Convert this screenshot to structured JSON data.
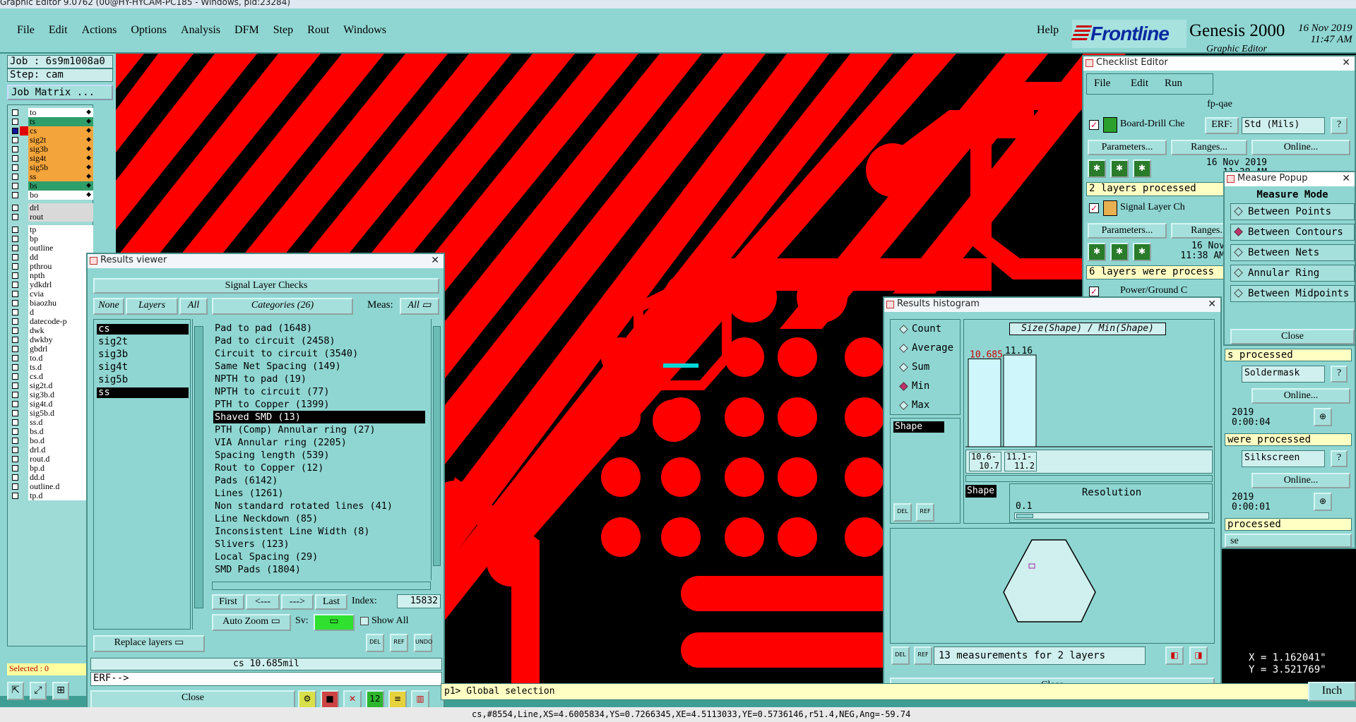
{
  "window_title": "Graphic Editor 9.0762 (00@HY-HYCAM-PC185 - Windows, pid:23284)",
  "menu": [
    "File",
    "Edit",
    "Actions",
    "Options",
    "Analysis",
    "DFM",
    "Step",
    "Rout",
    "Windows"
  ],
  "help": "Help",
  "brand": {
    "logo": "Frontline",
    "product": "Genesis 2000",
    "subtitle": "Graphic Editor",
    "date": "16 Nov 2019",
    "time": "11:47 AM"
  },
  "job": {
    "job": "Job : 6s9m1008a0",
    "step": "Step: cam",
    "matrix_btn": "Job Matrix ..."
  },
  "board_layers": [
    {
      "name": "to",
      "color": "#ffffff",
      "selected": false
    },
    {
      "name": "ts",
      "color": "#2e9e6a",
      "selected": false
    },
    {
      "name": "cs",
      "color": "#f3a43a",
      "selected": true
    },
    {
      "name": "sig2t",
      "color": "#f3a43a",
      "selected": false
    },
    {
      "name": "sig3b",
      "color": "#f3a43a",
      "selected": false
    },
    {
      "name": "sig4t",
      "color": "#f3a43a",
      "selected": false
    },
    {
      "name": "sig5b",
      "color": "#f3a43a",
      "selected": false
    },
    {
      "name": "ss",
      "color": "#f3a43a",
      "selected": false
    },
    {
      "name": "bs",
      "color": "#2e9e6a",
      "selected": false
    },
    {
      "name": "bo",
      "color": "#ffffff",
      "selected": false
    }
  ],
  "drill_layers": [
    "drl",
    "rout"
  ],
  "misc_layers": [
    "tp",
    "bp",
    "outline",
    "dd",
    "pthrou",
    "npth",
    "ydkdrl",
    "cvia",
    "biaozhu",
    "d",
    "datecode-p",
    "dwk",
    "dwkby",
    "gbdrl",
    "to.d",
    "ts.d",
    "cs.d",
    "sig2t.d",
    "sig3b.d",
    "sig4t.d",
    "sig5b.d",
    "ss.d",
    "bs.d",
    "bo.d",
    "drl.d",
    "rout.d",
    "bp.d",
    "dd.d",
    "outline.d",
    "tp.d"
  ],
  "selected": "Selected : 0",
  "results_viewer": {
    "title": "Results viewer",
    "header": "Signal Layer Checks",
    "none": "None",
    "layers": "Layers",
    "all": "All",
    "categories_label": "Categories (26)",
    "meas": "Meas:",
    "meas_val": "All",
    "layer_list": [
      "cs",
      "sig2t",
      "sig3b",
      "sig4t",
      "sig5b",
      "ss"
    ],
    "categories": [
      "Pad to pad (1648)",
      "Pad to circuit (2458)",
      "Circuit to circuit (3540)",
      "Same Net Spacing (149)",
      "NPTH to pad (19)",
      "NPTH to circuit (77)",
      "PTH to Copper (1399)",
      "Shaved SMD (13)",
      "PTH (Comp) Annular ring (27)",
      "VIA Annular ring (2205)",
      "Spacing length (539)",
      "Rout to Copper (12)",
      "Pads (6142)",
      "Lines (1261)",
      "Non standard rotated lines (41)",
      "Line Neckdown (85)",
      "Inconsistent Line Width (8)",
      "Slivers (123)",
      "Local Spacing (29)",
      "SMD Pads (1804)"
    ],
    "first": "First",
    "prev": "<---",
    "next": "--->",
    "last": "Last",
    "index_label": "Index:",
    "index_val": "15832",
    "auto_zoom": "Auto Zoom",
    "sv": "Sv:",
    "show_all": "Show All",
    "replace_layers": "Replace layers",
    "del": "DEL",
    "ref": "REF",
    "undo": "UNDO",
    "status": "cs 10.685mil",
    "erf": "ERF-->",
    "close": "Close"
  },
  "checklist": {
    "title": "Checklist Editor",
    "menu": [
      "File",
      "Edit",
      "Run"
    ],
    "name": "fp-qae",
    "erf": "ERF:",
    "params": "Parameters...",
    "ranges": "Ranges...",
    "online": "Online...",
    "items": [
      {
        "name": "Board-Drill Che",
        "erf": "Std (Mils)",
        "date": "16 Nov 2019",
        "time": "11:38 AM",
        "status": "2 layers processed"
      },
      {
        "name": "Signal Layer Ch",
        "erf": "",
        "date": "16 Nov",
        "time": "11:38 AM",
        "status": "6 layers were process"
      },
      {
        "name": "Power/Ground C",
        "erf": "",
        "date": "",
        "time": "",
        "status": "s processed"
      }
    ],
    "soldermask": "Soldermask",
    "silkscreen": "Silkscreen",
    "r1_date": "2019",
    "r1_time": "0:00:04",
    "r1_status": "were processed",
    "r2_date": "2019",
    "r2_time": "0:00:01",
    "r2_status": "processed",
    "se": "se"
  },
  "measure": {
    "title": "Measure Popup",
    "header": "Measure Mode",
    "modes": [
      {
        "label": "Between Points",
        "on": false
      },
      {
        "label": "Between Contours",
        "on": true
      },
      {
        "label": "Between Nets",
        "on": false
      },
      {
        "label": "Annular Ring",
        "on": false
      },
      {
        "label": "Between Midpoints",
        "on": false
      }
    ],
    "close": "Close"
  },
  "histogram": {
    "title": "Results histogram",
    "modes": [
      {
        "label": "Count",
        "on": false
      },
      {
        "label": "Average",
        "on": false
      },
      {
        "label": "Sum",
        "on": false
      },
      {
        "label": "Min",
        "on": true
      },
      {
        "label": "Max",
        "on": false
      }
    ],
    "chart_title": "Size(Shape) / Min(Shape)",
    "shape": "Shape",
    "bars": [
      {
        "label": "10.685",
        "range1": "10.6-",
        "range2": "10.7",
        "value": 10.685
      },
      {
        "label": "11.16",
        "range1": "11.1-",
        "range2": "11.2",
        "value": 11.16
      }
    ],
    "resolution_label": "Resolution",
    "resolution_val": "0.1",
    "measurements": "13 measurements for 2 layers",
    "del": "DEL",
    "ref": "REF",
    "close": "Close"
  },
  "cmdbar": "p1> Global selection",
  "coords": {
    "x": "X = 1.162041\"",
    "y": "Y = 3.521769\""
  },
  "units": "Inch",
  "statusline": "cs,#8554,Line,XS=4.6005834,YS=0.7266345,XE=4.5113033,YE=0.5736146,r51.4,NEG,Ang=-59.74",
  "colors": {
    "copper": "#ff0000",
    "bg": "#000000",
    "panel": "#8fd6d2",
    "highlight": "#00d0d0"
  }
}
